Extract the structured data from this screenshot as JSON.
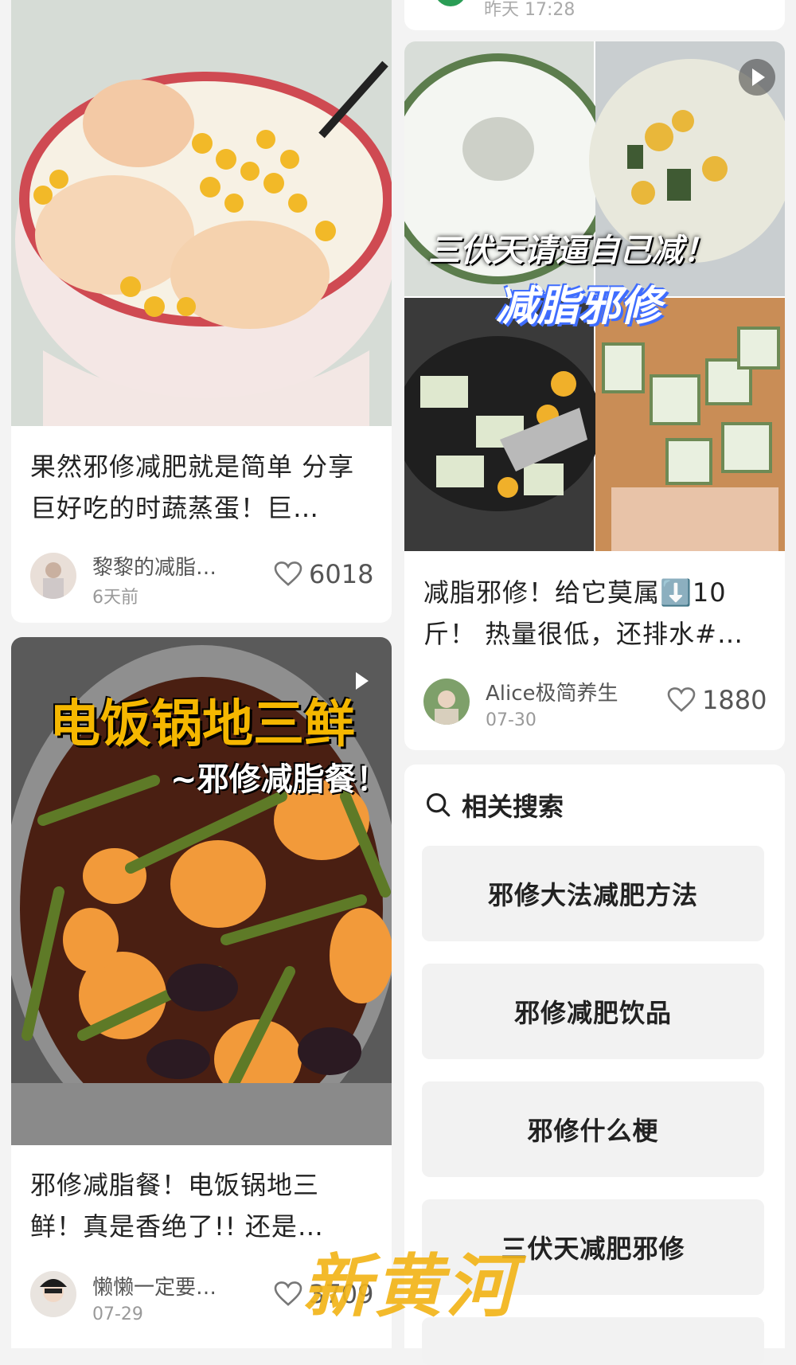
{
  "top_card": {
    "time": "昨天 17:28"
  },
  "feed": [
    {
      "title": "果然邪修减肥就是简单 分享巨好吃的时蔬蒸蛋！巨…",
      "author": "黎黎的减脂…",
      "time": "6天前",
      "likes": "6018"
    },
    {
      "title": "减脂邪修！给它莫属⬇️10斤！ 热量很低，还排水#…",
      "author": "Alice极简养生",
      "time": "07-30",
      "likes": "1880",
      "overlay_line1": "三伏天请逼自己减！",
      "overlay_line2": "减脂邪修"
    },
    {
      "title": "邪修减脂餐！电饭锅地三鲜！真是香绝了!! 还是…",
      "author": "懒懒一定要…",
      "time": "07-29",
      "likes": "3709",
      "overlay_line1": "电饭锅地三鲜",
      "overlay_line2": "~邪修减脂餐！"
    }
  ],
  "related": {
    "title": "相关搜索",
    "items": [
      "邪修大法减肥方法",
      "邪修减肥饮品",
      "邪修什么梗",
      "三伏天减肥邪修"
    ]
  },
  "watermark": "新黄河",
  "colors": {
    "accent_orange": "#f5b700",
    "overlay_blue": "#3f6dff",
    "heart_gray": "#777777"
  }
}
